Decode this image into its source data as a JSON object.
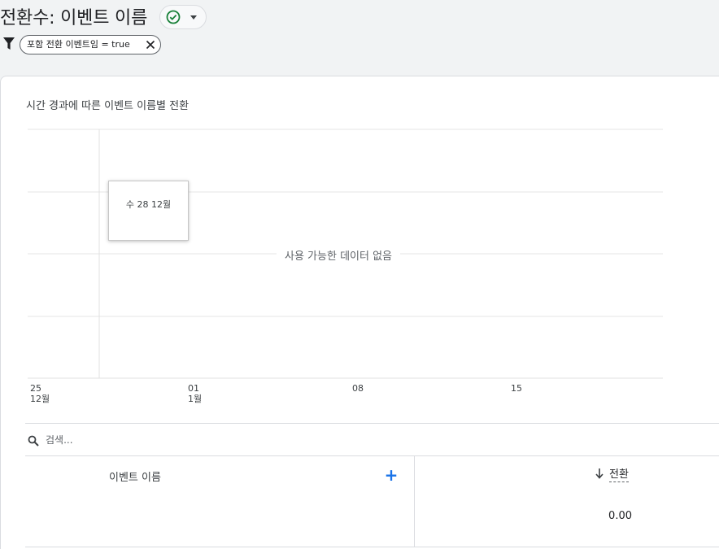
{
  "header": {
    "title": "전환수: 이벤트 이름",
    "status_icon": "check-circle-icon",
    "dropdown_icon": "caret-down-icon"
  },
  "filter": {
    "icon": "filter-icon",
    "chip_label": "포함 전환 이벤트임 = true",
    "chip_close_icon": "close-icon"
  },
  "chart": {
    "title": "시간 경과에 따른 이벤트 이름별 전환",
    "no_data_text": "사용 가능한 데이터 없음",
    "tooltip_text": "수 28 12월"
  },
  "chart_data": {
    "type": "line",
    "title": "시간 경과에 따른 이벤트 이름별 전환",
    "x_ticks": [
      {
        "day": "25",
        "month": "12월"
      },
      {
        "day": "01",
        "month": "1월"
      },
      {
        "day": "08",
        "month": ""
      },
      {
        "day": "15",
        "month": ""
      }
    ],
    "series": [],
    "grid": true,
    "annotation": "사용 가능한 데이터 없음"
  },
  "search": {
    "placeholder": "검색...",
    "value": ""
  },
  "table": {
    "columns": [
      "이벤트 이름",
      "전환"
    ],
    "add_dimension_label": "+",
    "sort_direction": "descending",
    "total_conversions": "0.00"
  },
  "colors": {
    "accent": "#1a73e8",
    "success": "#188038",
    "background": "#f1f3f4",
    "grid": "#e0e0e0"
  }
}
